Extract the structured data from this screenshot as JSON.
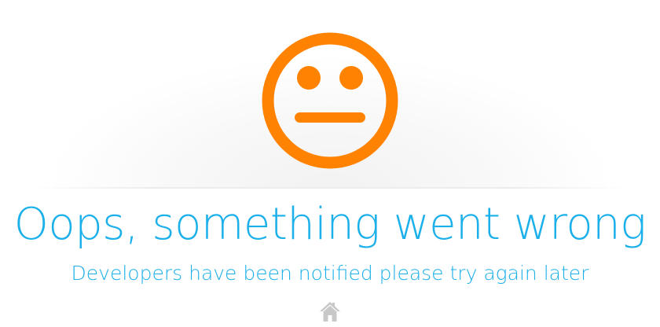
{
  "error": {
    "face_icon": "neutral-face-icon",
    "face_color": "#ff8200",
    "title": "Oops, something went wrong",
    "subtitle": "Developers have been notified please try again later",
    "text_color": "#1cb0ea"
  },
  "nav": {
    "home_icon": "home-icon",
    "home_icon_color": "#c8c8c8"
  }
}
